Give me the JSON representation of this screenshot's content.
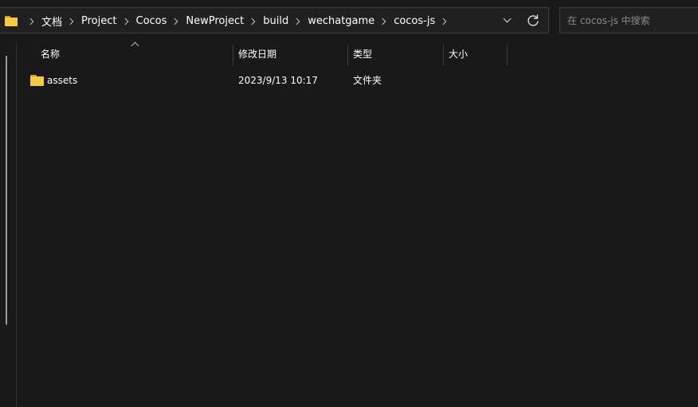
{
  "address_bar": {
    "breadcrumbs": [
      "文档",
      "Project",
      "Cocos",
      "NewProject",
      "build",
      "wechatgame",
      "cocos-js"
    ]
  },
  "search": {
    "placeholder": "在 cocos-js 中搜索",
    "value": ""
  },
  "columns": {
    "name": "名称",
    "date_modified": "修改日期",
    "type": "类型",
    "size": "大小"
  },
  "files": [
    {
      "name": "assets",
      "date_modified": "2023/9/13 10:17",
      "type": "文件夹",
      "size": "",
      "icon": "folder-icon"
    }
  ],
  "colors": {
    "background": "#191919",
    "folder": "#f7c948",
    "border": "#3c3c3c"
  }
}
